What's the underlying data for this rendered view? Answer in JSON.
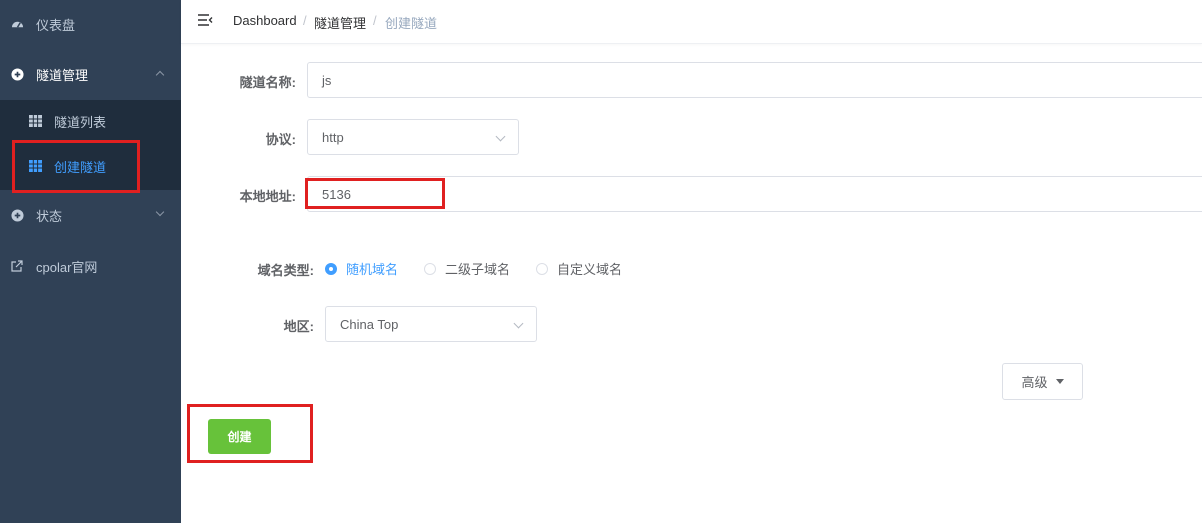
{
  "sidebar": {
    "dashboard": "仪表盘",
    "tunnel_mgmt": "隧道管理",
    "tunnel_list": "隧道列表",
    "create_tunnel": "创建隧道",
    "status": "状态",
    "website": "cpolar官网"
  },
  "breadcrumb": [
    "Dashboard",
    "隧道管理",
    "创建隧道"
  ],
  "breadcrumb_sep": "/",
  "form": {
    "name_label": "隧道名称:",
    "name_value": "js",
    "protocol_label": "协议:",
    "protocol_value": "http",
    "local_label": "本地地址:",
    "local_value": "5136",
    "domain_type_label": "域名类型:",
    "domain_options": [
      "随机域名",
      "二级子域名",
      "自定义域名"
    ],
    "region_label": "地区:",
    "region_value": "China Top",
    "advanced_label": "高级",
    "create_label": "创建"
  },
  "colors": {
    "accent": "#409eff",
    "success": "#67c23a",
    "sidebar": "#304156",
    "highlight": "#e02020"
  }
}
